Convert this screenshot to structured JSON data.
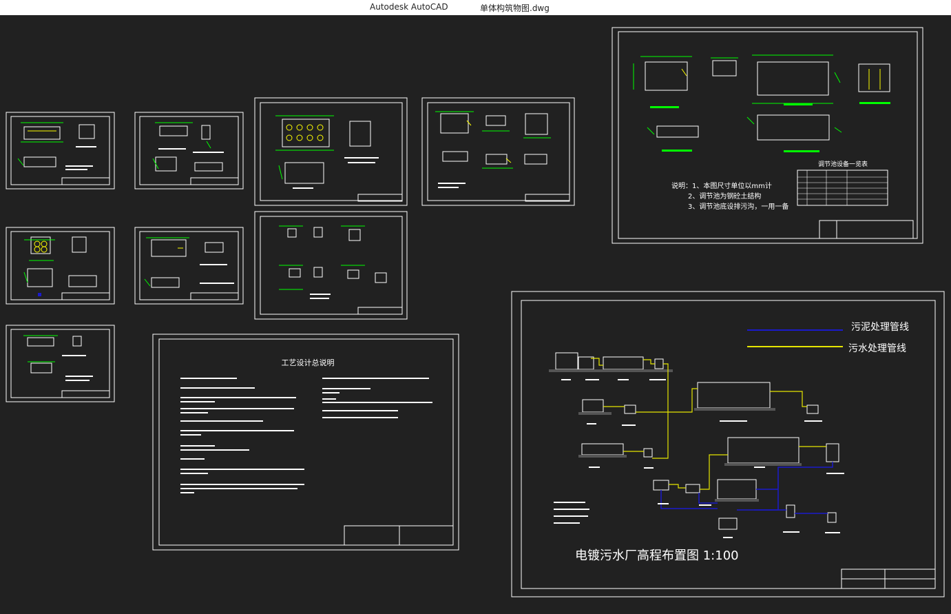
{
  "window": {
    "app_name": "Autodesk AutoCAD",
    "file_name": "单体构筑物图.dwg"
  },
  "colors": {
    "background": "#212121",
    "frame": "#ffffff",
    "dimension": "#00ff00",
    "annotation": "#ffff00",
    "sludge_line": "#1a1acc",
    "sewage_line": "#e6e600"
  },
  "sheets": {
    "regulating_tank": {
      "table_title": "调节池设备一览表",
      "notes": [
        "说明：1、本图尺寸单位以mm计",
        "2、调节池为钢砼土结构",
        "3、调节池底设排污沟，一用一备"
      ]
    },
    "design_manual": {
      "title": "工艺设计总说明"
    },
    "elevation_layout": {
      "legend": [
        {
          "label": "污泥处理管线",
          "color_key": "sludge_line"
        },
        {
          "label": "污水处理管线",
          "color_key": "sewage_line"
        }
      ],
      "title": "电镀污水厂高程布置图 1:100"
    }
  }
}
